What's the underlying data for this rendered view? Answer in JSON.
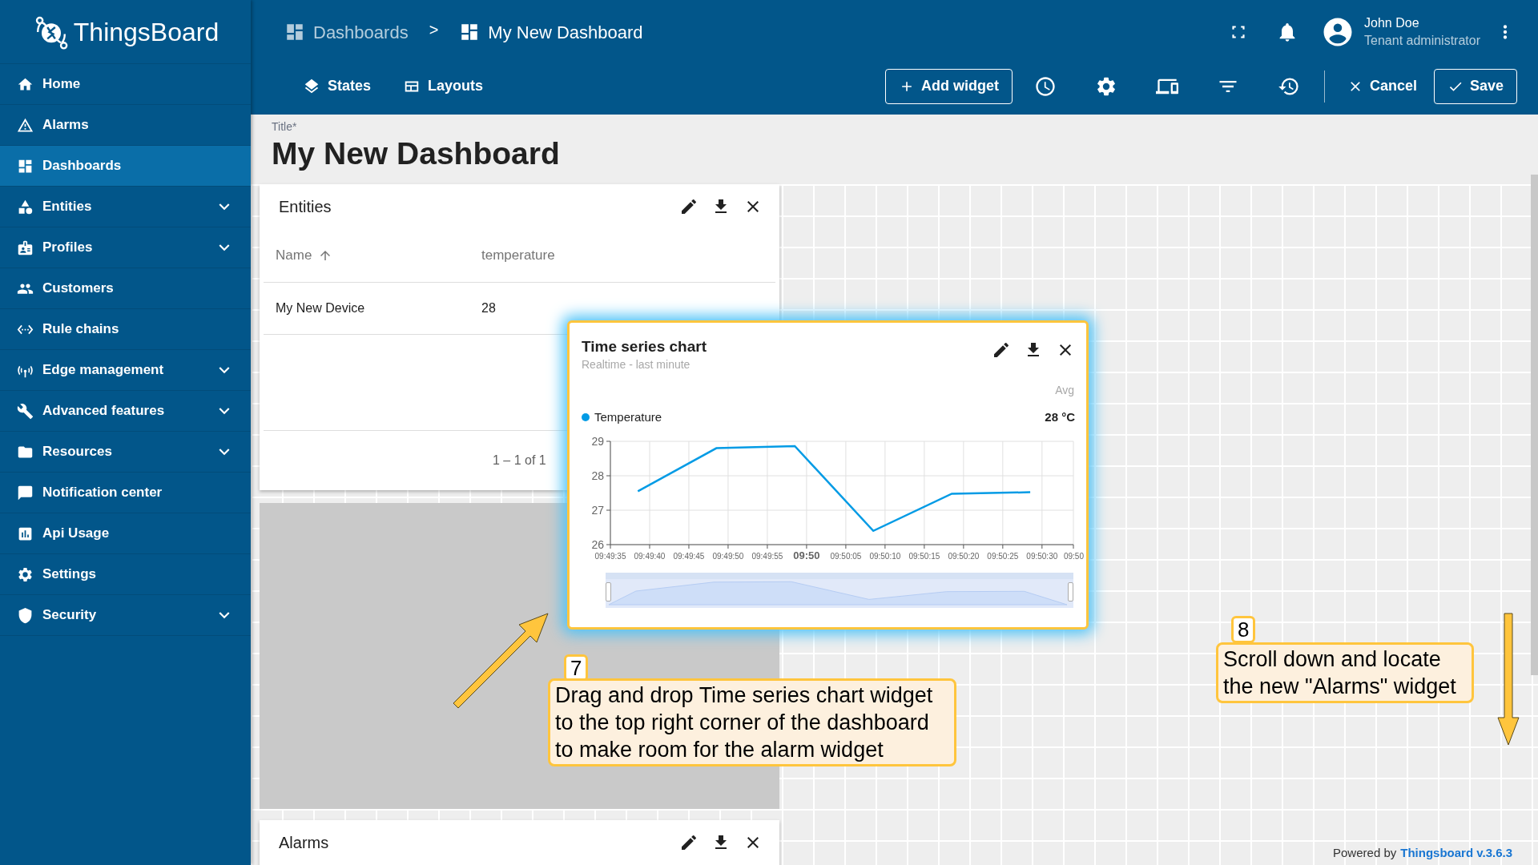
{
  "header": {
    "app_name": "ThingsBoard",
    "separator": ">",
    "breadcrumbs": [
      {
        "label": "Dashboards",
        "current": false
      },
      {
        "label": "My New Dashboard",
        "current": true
      }
    ],
    "user": {
      "name": "John Doe",
      "role": "Tenant administrator"
    }
  },
  "sidebar": {
    "items": [
      {
        "label": "Home",
        "selected": false
      },
      {
        "label": "Alarms",
        "selected": false
      },
      {
        "label": "Dashboards",
        "selected": true
      },
      {
        "label": "Entities",
        "selected": false,
        "expanded": false
      },
      {
        "label": "Profiles",
        "selected": false,
        "expanded": false
      },
      {
        "label": "Customers",
        "selected": false
      },
      {
        "label": "Rule chains",
        "selected": false
      },
      {
        "label": "Edge management",
        "selected": false,
        "expanded": false
      },
      {
        "label": "Advanced features",
        "selected": false,
        "expanded": false
      },
      {
        "label": "Resources",
        "selected": false,
        "expanded": false
      },
      {
        "label": "Notification center",
        "selected": false
      },
      {
        "label": "Api Usage",
        "selected": false
      },
      {
        "label": "Settings",
        "selected": false
      },
      {
        "label": "Security",
        "selected": false,
        "expanded": false
      }
    ]
  },
  "toolbar": {
    "tabs": [
      {
        "label": "States"
      },
      {
        "label": "Layouts"
      }
    ],
    "add_widget": "Add widget",
    "cancel": "Cancel",
    "save": "Save"
  },
  "title": {
    "label": "Title*",
    "value": "My New Dashboard"
  },
  "entities_widget": {
    "title": "Entities",
    "columns": [
      {
        "label": "Name",
        "sort_ascending": true
      },
      {
        "label": "temperature"
      }
    ],
    "rows": [
      [
        "My New Device",
        "28"
      ]
    ],
    "pagination": "1 – 1 of 1"
  },
  "chart_widget": {
    "title": "Time series chart",
    "subtitle": "Realtime - last minute",
    "stat_header": "Avg",
    "legend": [
      {
        "value": "28 °C"
      }
    ],
    "range_slider": {
      "level": 1
    },
    "chart_data": {
      "type": "line",
      "x": [
        35378.5,
        35388.5,
        35398.5,
        35408.5,
        35418.5,
        35428.5
      ],
      "series": [
        {
          "name": "Temperature",
          "color": "#039be5",
          "values": [
            27.55,
            28.8,
            28.86,
            26.4,
            27.48,
            27.52
          ]
        }
      ],
      "xlim": [
        35375,
        35434
      ],
      "ylim": [
        26,
        29
      ],
      "grid": true,
      "yticks": [
        26,
        27,
        28,
        29
      ],
      "xticks": [
        {
          "value": 35375,
          "label": "09:49:35"
        },
        {
          "value": 35380,
          "label": "09:49:40"
        },
        {
          "value": 35385,
          "label": "09:49:45"
        },
        {
          "value": 35390,
          "label": "09:49:50"
        },
        {
          "value": 35395,
          "label": "09:49:55"
        },
        {
          "value": 35400,
          "label": "09:50"
        },
        {
          "value": 35405,
          "label": "09:50:05"
        },
        {
          "value": 35410,
          "label": "09:50:10"
        },
        {
          "value": 35415,
          "label": "09:50:15"
        },
        {
          "value": 35420,
          "label": "09:50:20"
        },
        {
          "value": 35425,
          "label": "09:50:25"
        },
        {
          "value": 35430,
          "label": "09:50:30"
        }
      ]
    },
    "axis_end_label": "09:50"
  },
  "alarms_widget": {
    "title": "Alarms"
  },
  "annotations": [
    {
      "number": "7",
      "text": "Drag and drop Time series chart widget to the top right corner of the dashboard to make room for the alarm widget"
    },
    {
      "number": "8",
      "text": "Scroll down and locate the new \"Alarms\" widget"
    }
  ],
  "footer": {
    "prefix": "Powered by",
    "link": "Thingsboard v.3.6.3"
  }
}
